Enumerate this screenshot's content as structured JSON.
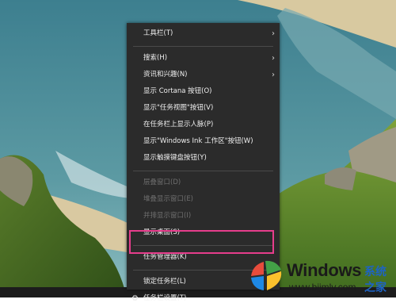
{
  "menu": {
    "items": [
      {
        "label": "工具栏(T)"
      },
      {
        "label": "搜索(H)"
      },
      {
        "label": "资讯和兴趣(N)"
      },
      {
        "label": "显示 Cortana 按钮(O)"
      },
      {
        "label": "显示\"任务视图\"按钮(V)"
      },
      {
        "label": "在任务栏上显示人脉(P)"
      },
      {
        "label": "显示\"Windows Ink 工作区\"按钮(W)"
      },
      {
        "label": "显示触摸键盘按钮(Y)"
      },
      {
        "label": "层叠窗口(D)"
      },
      {
        "label": "堆叠显示窗口(E)"
      },
      {
        "label": "并排显示窗口(I)"
      },
      {
        "label": "显示桌面(S)"
      },
      {
        "label": "任务管理器(K)"
      },
      {
        "label": "锁定任务栏(L)"
      },
      {
        "label": "任务栏设置(T)"
      }
    ],
    "submenu_glyph": "›"
  },
  "watermark": {
    "title": "Windows",
    "subtitle": "系统之家",
    "url": "www.bjjmlv.com"
  },
  "colors": {
    "menu_bg": "#2b2b2b",
    "highlight": "#e63d8c"
  }
}
